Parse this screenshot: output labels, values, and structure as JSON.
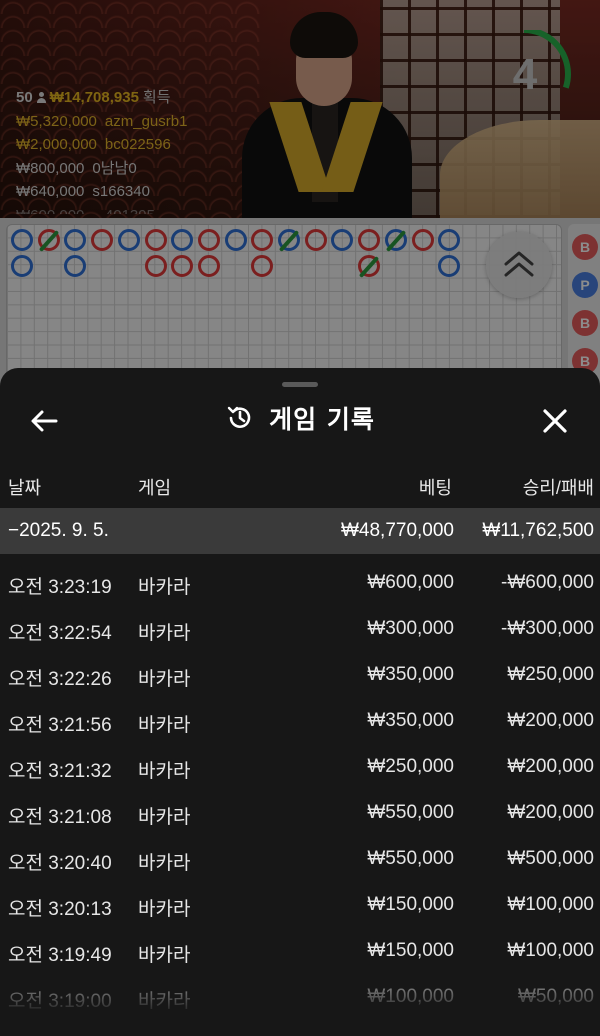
{
  "stream": {
    "countdown": "4",
    "countdown_progress": 0.3,
    "winners": {
      "count": "50",
      "total": "₩14,708,935",
      "suffix": "획득",
      "rows": [
        {
          "amount": "₩5,320,000",
          "user": "azm_gusrb1",
          "tone": "gold"
        },
        {
          "amount": "₩2,000,000",
          "user": "bc022596",
          "tone": "gold"
        },
        {
          "amount": "₩800,000",
          "user": "0남남0",
          "tone": "white"
        },
        {
          "amount": "₩640,000",
          "user": "s166340",
          "tone": "white"
        },
        {
          "amount": "₩600,000",
          "user": "...401395",
          "tone": "white"
        }
      ]
    }
  },
  "roadmap": {
    "side_chips": [
      {
        "letter": "B",
        "color": "#e45b5b"
      },
      {
        "letter": "P",
        "color": "#4a7fe0"
      },
      {
        "letter": "B",
        "color": "#e45b5b"
      },
      {
        "letter": "B",
        "color": "#e45b5b"
      }
    ]
  },
  "history": {
    "title": "게임 기록",
    "columns": {
      "date": "날짜",
      "game": "게임",
      "bet": "베팅",
      "win": "승리/패배"
    },
    "date_group": {
      "date": "−2025. 9. 5.",
      "bet_total": "₩48,770,000",
      "win_total": "₩11,762,500"
    },
    "rows": [
      {
        "time": "오전 3:23:19",
        "game": "바카라",
        "bet": "₩600,000",
        "result": "-₩600,000"
      },
      {
        "time": "오전 3:22:54",
        "game": "바카라",
        "bet": "₩300,000",
        "result": "-₩300,000"
      },
      {
        "time": "오전 3:22:26",
        "game": "바카라",
        "bet": "₩350,000",
        "result": "₩250,000"
      },
      {
        "time": "오전 3:21:56",
        "game": "바카라",
        "bet": "₩350,000",
        "result": "₩200,000"
      },
      {
        "time": "오전 3:21:32",
        "game": "바카라",
        "bet": "₩250,000",
        "result": "₩200,000"
      },
      {
        "time": "오전 3:21:08",
        "game": "바카라",
        "bet": "₩550,000",
        "result": "₩200,000"
      },
      {
        "time": "오전 3:20:40",
        "game": "바카라",
        "bet": "₩550,000",
        "result": "₩500,000"
      },
      {
        "time": "오전 3:20:13",
        "game": "바카라",
        "bet": "₩150,000",
        "result": "₩100,000"
      },
      {
        "time": "오전 3:19:49",
        "game": "바카라",
        "bet": "₩150,000",
        "result": "₩100,000"
      },
      {
        "time": "오전 3:19:00",
        "game": "바카라",
        "bet": "₩100,000",
        "result": "₩50,000"
      }
    ]
  }
}
